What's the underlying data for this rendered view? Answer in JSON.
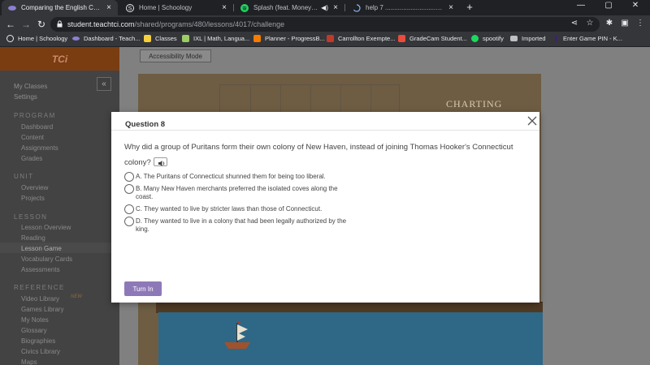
{
  "browser": {
    "tabs": [
      {
        "title": "Comparing the English Colonies",
        "active": true,
        "icon": "tci-icon"
      },
      {
        "title": "Home | Schoology",
        "active": false,
        "icon": "schoology-icon"
      },
      {
        "title": "Splash (feat. Moneybagg Yo)",
        "active": false,
        "icon": "spotify-icon"
      },
      {
        "title": "help 7 ........................................",
        "active": false,
        "icon": "loading-icon"
      }
    ],
    "url_host": "student.teachtci.com",
    "url_path": "/shared/programs/480/lessons/4017/challenge",
    "bookmarks": [
      "Home | Schoology",
      "Dashboard - Teach...",
      "Classes",
      "IXL | Math, Langua...",
      "Planner - ProgressB...",
      "Carrollton Exempte...",
      "GradeCam Student...",
      "spootify",
      "Imported",
      "Enter Game PIN - K..."
    ]
  },
  "sidebar": {
    "logo": "TCi",
    "top_links": [
      "My Classes",
      "Settings"
    ],
    "sections": [
      {
        "heading": "PROGRAM",
        "items": [
          "Dashboard",
          "Content",
          "Assignments",
          "Grades"
        ]
      },
      {
        "heading": "UNIT",
        "items": [
          "Overview",
          "Projects"
        ]
      },
      {
        "heading": "LESSON",
        "items": [
          "Lesson Overview",
          "Reading",
          "Lesson Game",
          "Vocabulary Cards",
          "Assessments"
        ]
      },
      {
        "heading": "REFERENCE",
        "items": [
          "Video Library",
          "Games Library",
          "My Notes",
          "Glossary",
          "Biographies",
          "Civics Library",
          "Maps"
        ]
      }
    ],
    "new_badge": "NEW"
  },
  "main": {
    "accessibility_label": "Accessibility Mode",
    "game_title": "CHARTING"
  },
  "modal": {
    "title": "Question 8",
    "question": "Why did a group of Puritans form their own colony of New Haven, instead of joining Thomas Hooker's Connecticut colony?",
    "options": [
      "A. The Puritans of Connecticut shunned them for being too liberal.",
      "B. Many New Haven merchants preferred the isolated coves along the coast.",
      "C. They wanted to live by stricter laws than those of Connecticut.",
      "D. They wanted to live in a colony that had been legally authorized by the king."
    ],
    "submit_label": "Turn In"
  },
  "colors": {
    "accent_purple": "#8e79b8",
    "logo_brown": "#7a3d12",
    "sidebar": "#434343"
  }
}
